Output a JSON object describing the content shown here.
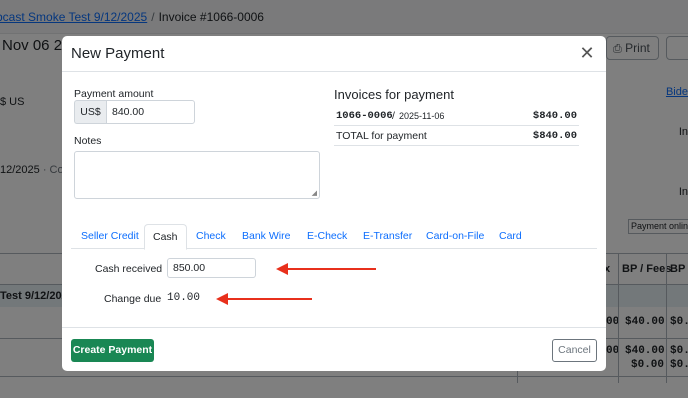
{
  "background": {
    "breadcrumb": {
      "link": "bcast Smoke Test 9/12/2025",
      "separator": "/",
      "current": "Invoice #1066-0006"
    },
    "date_title": "Nov 06 202",
    "currency_fragment": "$ US",
    "date_fragment": "12/2025",
    "date_fragment_muted": " · Com",
    "print_label": "Print",
    "right_link": "Bide",
    "right_fragment_1": "In",
    "right_fragment_2": "In",
    "payment_online": "Payment online",
    "table_head": {
      "col_x": "x",
      "bp_fees": "BP / Fees",
      "bp_t": "BP T"
    },
    "group_row_label": "Test 9/12/202",
    "rows": [
      {
        "bp_fees": "$40.00",
        "bp_t": "$0."
      },
      {
        "bp_fees": "$40.00",
        "bp_fees_2": "$0.00",
        "bp_t": "$0.",
        "bp_t_2": "$0."
      }
    ],
    "row_fragments": {
      "r1": "00",
      "r2": "00"
    }
  },
  "modal": {
    "title": "New Payment",
    "close_icon": "close-icon",
    "payment_amount_label": "Payment amount",
    "currency_prefix": "US$",
    "amount_value": "840.00",
    "notes_label": "Notes",
    "notes_value": "",
    "invoices_title": "Invoices for payment",
    "invoice": {
      "number": "1066-0006",
      "separator": "/",
      "date": "2025-11-06",
      "amount": "$840.00"
    },
    "total_label": "TOTAL for payment",
    "total_amount": "$840.00",
    "tabs": [
      "Seller Credit",
      "Cash",
      "Check",
      "Bank Wire",
      "E-Check",
      "E-Transfer",
      "Card-on-File",
      "Card"
    ],
    "active_tab": "Cash",
    "cash_received_label": "Cash received",
    "cash_received_value": "850.00",
    "change_due_label": "Change due",
    "change_due_value": "10.00",
    "create_button": "Create Payment",
    "cancel_button": "Cancel"
  },
  "colors": {
    "primary_link": "#0d6efd",
    "success": "#198754",
    "annotation_arrow": "#e8301c",
    "overlay": "rgba(0,0,0,0.5)"
  }
}
